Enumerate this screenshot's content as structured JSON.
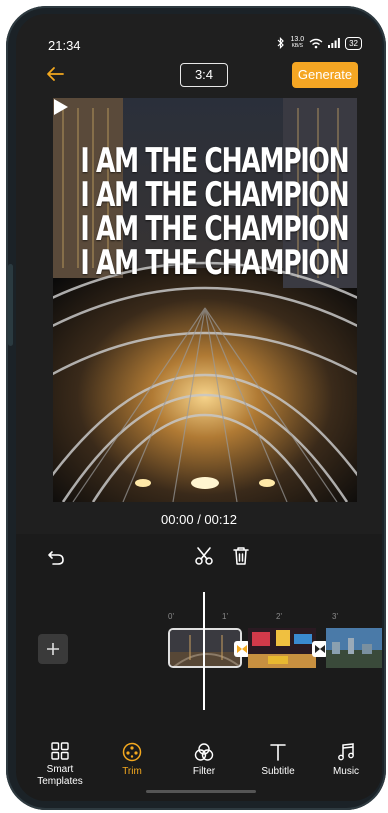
{
  "status_bar": {
    "time": "21:34",
    "net_speed_value": "13.0",
    "net_speed_unit": "KB/S",
    "battery": "32"
  },
  "top_bar": {
    "aspect_ratio": "3:4",
    "generate_label": "Generate"
  },
  "preview": {
    "overlay_lines": [
      "I AM THE CHAMPION",
      "I AM THE CHAMPION",
      "I AM THE CHAMPION",
      "I AM THE CHAMPION"
    ]
  },
  "playback": {
    "timecode": "00:00 / 00:12"
  },
  "timeline": {
    "ticks": [
      "0'",
      "1'",
      "2'",
      "3'"
    ]
  },
  "tabs": [
    {
      "label": "Smart\nTemplates",
      "icon": "grid-icon"
    },
    {
      "label": "Trim",
      "icon": "trim-icon",
      "active": true
    },
    {
      "label": "Filter",
      "icon": "filter-icon"
    },
    {
      "label": "Subtitle",
      "icon": "subtitle-icon"
    },
    {
      "label": "Music",
      "icon": "music-icon"
    }
  ],
  "colors": {
    "accent": "#f5a623",
    "background": "#1f1f1f"
  }
}
